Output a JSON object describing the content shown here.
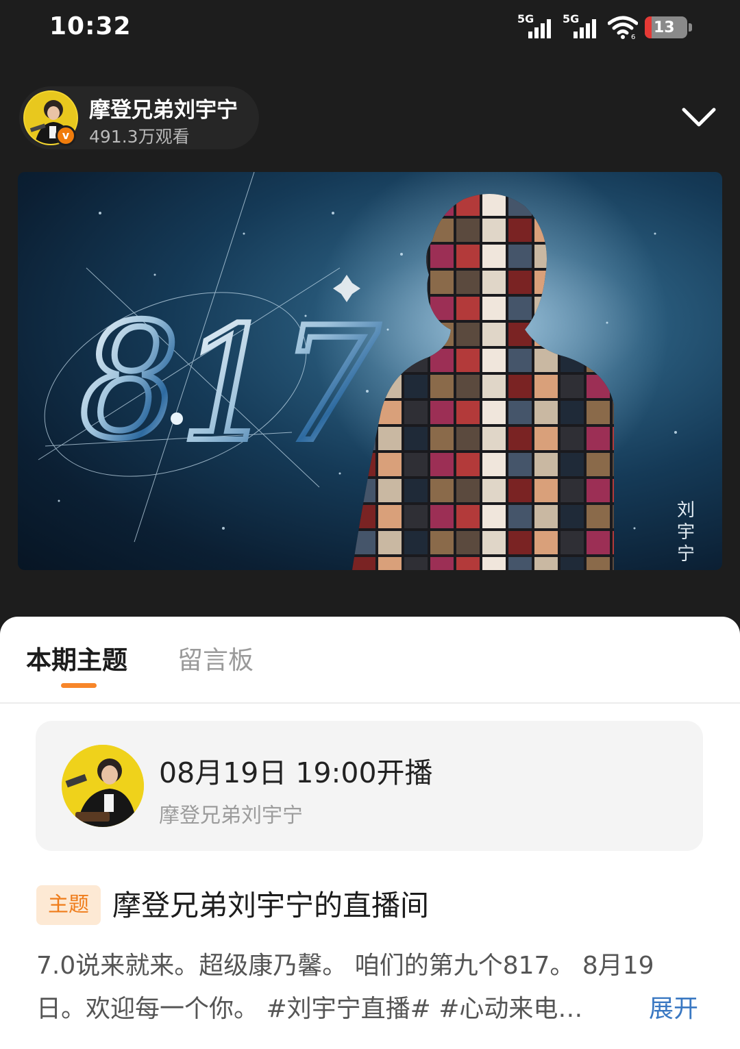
{
  "status_bar": {
    "time": "10:32",
    "network_1": "5G",
    "network_2": "5G",
    "battery_level": "13",
    "battery_low_color": "#e53935"
  },
  "host": {
    "name": "摩登兄弟刘宇宁",
    "views": "491.3万观看",
    "verified_icon": "v-verified-badge",
    "collapse_icon": "chevron-down-icon"
  },
  "poster": {
    "date_text": "8.17",
    "artist_name": "刘宇宁"
  },
  "tabs": [
    {
      "label": "本期主题",
      "active": true
    },
    {
      "label": "留言板",
      "active": false
    }
  ],
  "schedule": {
    "time": "08月19日 19:00开播",
    "host": "摩登兄弟刘宇宁"
  },
  "topic": {
    "tag": "主题",
    "title": "摩登兄弟刘宇宁的直播间",
    "description_line1": "7.0说来就来。超级康乃馨。 咱们的第九个817。 8月19",
    "description_line2": "日。欢迎每一个你。 #刘宇宁直播# #心动来电…",
    "expand_label": "展开"
  },
  "colors": {
    "accent_orange": "#f7862a",
    "link_blue": "#3a78c2",
    "dark_bg": "#1d1d1d"
  }
}
